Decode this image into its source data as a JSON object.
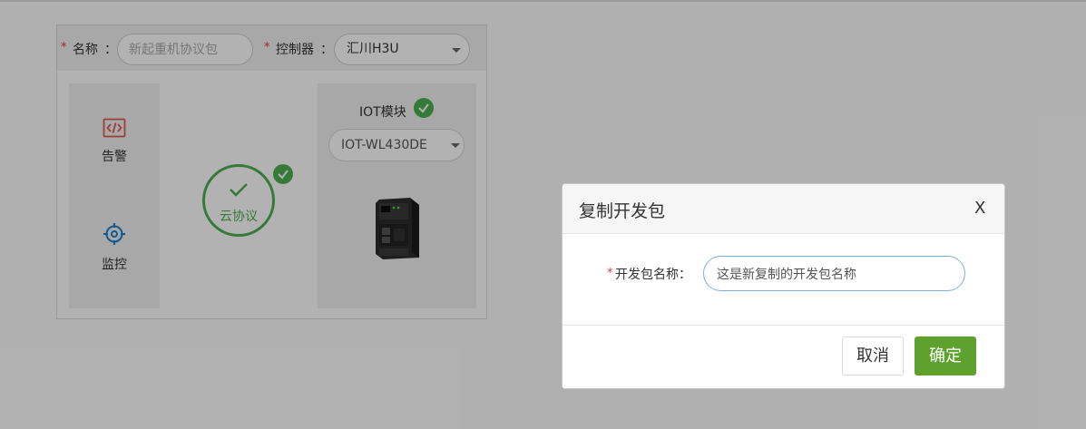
{
  "form": {
    "name_label": "名称",
    "name_colon": "：",
    "name_placeholder": "新起重机协议包",
    "controller_label": "控制器",
    "controller_colon": "：",
    "controller_value": "汇川H3U",
    "required_mark": "*"
  },
  "tools": [
    {
      "label": "告警",
      "icon": "code-icon"
    },
    {
      "label": "监控",
      "icon": "crosshair-icon"
    }
  ],
  "cloud": {
    "label": "云协议",
    "icon": "check-icon"
  },
  "iot": {
    "title": "IOT模块",
    "selected": "IOT-WL430DE",
    "image": "iot-device-image"
  },
  "dialog": {
    "title": "复制开发包",
    "close": "X",
    "required_mark": "*",
    "field_label": "开发包名称：",
    "field_value": "这是新复制的开发包名称",
    "cancel": "取消",
    "confirm": "确定"
  },
  "colors": {
    "success": "#4caf50",
    "primary_button": "#5fa12e",
    "alarm_icon": "#e05a4e",
    "monitor_icon": "#1e7fd1",
    "required": "#e4393c",
    "overlay": "rgba(0,0,0,0.30)"
  }
}
